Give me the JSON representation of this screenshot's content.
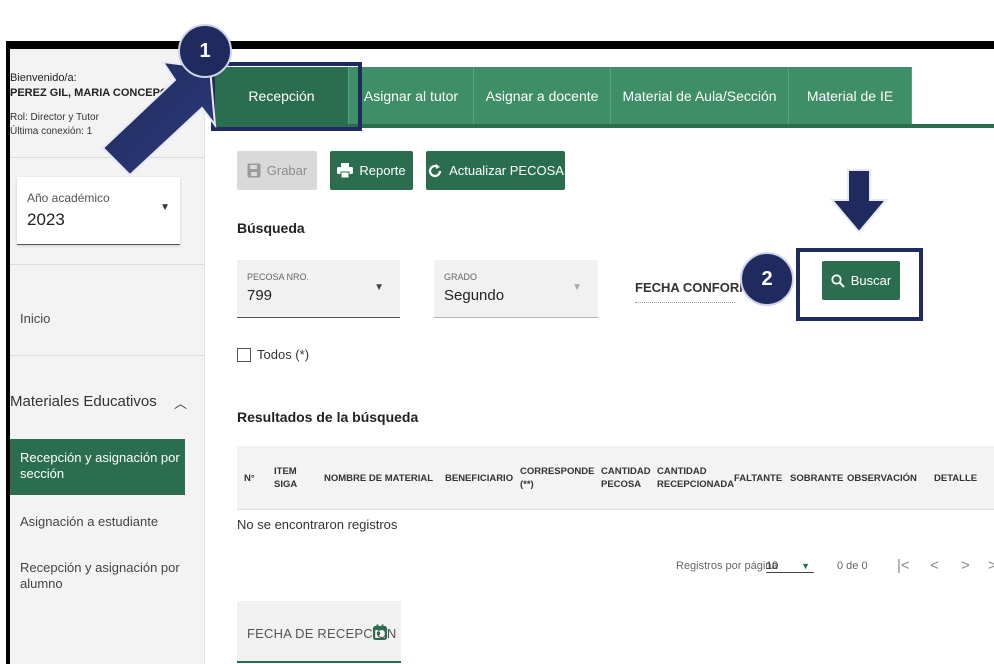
{
  "sidebar": {
    "welcome": "Bienvenido/a:",
    "user_name": "PEREZ GIL, MARIA CONCEPCIO",
    "role": "Rol: Director y Tutor",
    "last_login": "Última conexión: 1",
    "academic_year": {
      "label": "Año académico",
      "value": "2023"
    },
    "home": "Inicio",
    "group": "Materiales Educativos",
    "items": [
      {
        "label": "Recepción y asignación por sección",
        "active": true
      },
      {
        "label": "Asignación a estudiante",
        "active": false
      },
      {
        "label": "Recepción y asignación por alumno",
        "active": false
      }
    ]
  },
  "tabs": [
    {
      "label": "Recepción",
      "active": true
    },
    {
      "label": "Asignar al tutor",
      "active": false
    },
    {
      "label": "Asignar a docente",
      "active": false
    },
    {
      "label": "Material de Aula/Sección",
      "active": false
    },
    {
      "label": "Material de IE",
      "active": false
    }
  ],
  "toolbar": {
    "save": "Grabar",
    "report": "Reporte",
    "update": "Actualizar PECOSA"
  },
  "search": {
    "title": "Búsqueda",
    "pecosa": {
      "label": "PECOSA NRO.",
      "value": "799"
    },
    "grado": {
      "label": "GRADO",
      "value": "Segundo"
    },
    "fecha_conformidad": "FECHA CONFORMI",
    "button": "Buscar",
    "all_checkbox": "Todos (*)"
  },
  "annotations": {
    "step1": "1",
    "step2": "2"
  },
  "results": {
    "title": "Resultados de la búsqueda",
    "columns": [
      "N°",
      "ITEM SIGA",
      "NOMBRE DE MATERIAL",
      "BENEFICIARIO",
      "CORRESPONDE (**)",
      "CANTIDAD PECOSA",
      "CANTIDAD RECEPCIONADA",
      "FALTANTE",
      "SOBRANTE",
      "OBSERVACIÓN",
      "DETALLE"
    ],
    "empty": "No se encontraron registros"
  },
  "pagination": {
    "per_page_label": "Registros por página",
    "per_page": "10",
    "range": "0 de 0"
  },
  "reception_date": {
    "label": "FECHA DE RECEPCIÓN"
  },
  "colors": {
    "primary": "#2b6e4f",
    "tab": "#3e8e67",
    "annotation": "#1f2a5e"
  }
}
